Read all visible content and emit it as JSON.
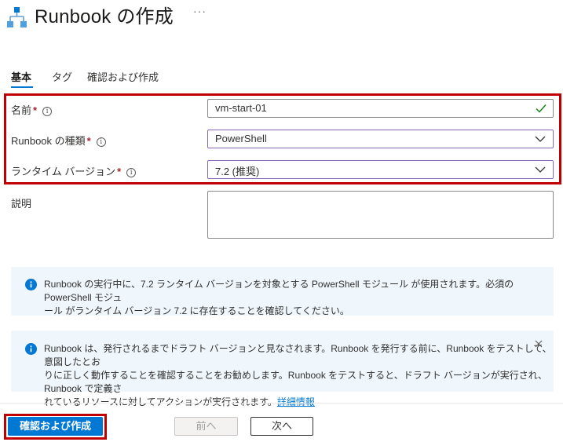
{
  "header": {
    "title": "Runbook の作成",
    "more": "···"
  },
  "tabs": [
    {
      "label": "基本"
    },
    {
      "label": "タグ"
    },
    {
      "label": "確認および作成"
    }
  ],
  "form": {
    "name": {
      "label": "名前",
      "required": "*",
      "value": "vm-start-01"
    },
    "runbook_type": {
      "label": "Runbook の種類",
      "required": "*",
      "value": "PowerShell"
    },
    "runtime_version": {
      "label": "ランタイム バージョン",
      "required": "*",
      "value": "7.2 (推奨)"
    },
    "description": {
      "label": "説明",
      "value": ""
    }
  },
  "info_icon_glyph": "i",
  "info1": {
    "line1": "Runbook の実行中に、7.2 ランタイム バージョンを対象とする PowerShell モジュール が使用されます。必須の PowerShell モジュ",
    "line2": "ール がランタイム バージョン 7.2 に存在することを確認してください。"
  },
  "info2": {
    "line1": "Runbook は、発行されるまでドラフト バージョンと見なされます。Runbook を発行する前に、Runbook をテストして、意図したとお",
    "line2": "りに正しく動作することを確認することをお勧めします。Runbook をテストすると、ドラフト バージョンが実行され、Runbook で定義さ",
    "line3": "れているリソースに対してアクションが実行されます。",
    "link": "詳細情報"
  },
  "footer": {
    "review_create": "確認および作成",
    "previous": "前へ",
    "next": "次へ"
  },
  "colors": {
    "accent": "#0078d4",
    "highlight": "#c00000",
    "info_bg": "#eff6fc",
    "check": "#107c10"
  }
}
